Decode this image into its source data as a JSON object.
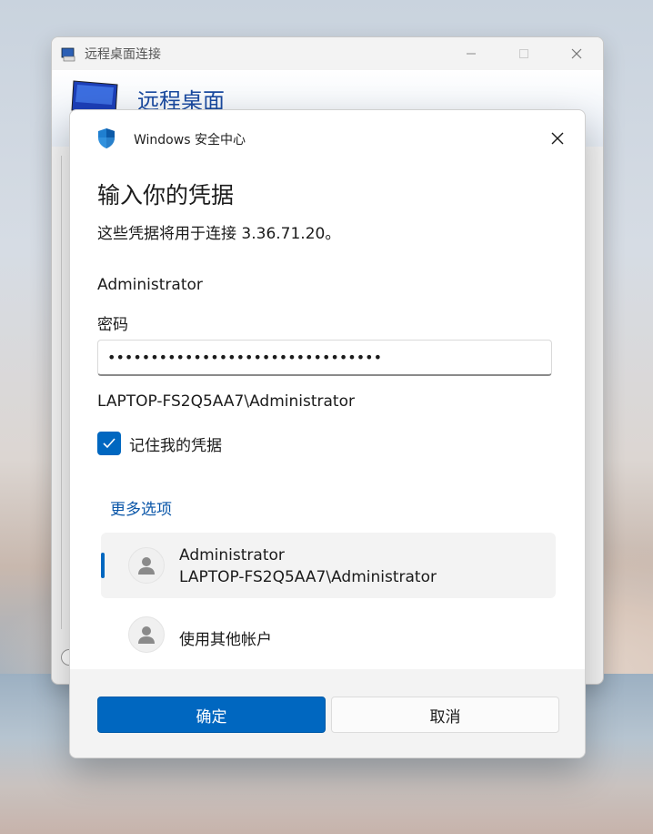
{
  "rdp_window": {
    "title": "远程桌面连接",
    "banner_title": "远程桌面"
  },
  "dialog": {
    "header_title": "Windows 安全中心",
    "heading": "输入你的凭据",
    "subtext": "这些凭据将用于连接 3.36.71.20。",
    "username": "Administrator",
    "password_label": "密码",
    "password_value": "••••••••••••••••••••••••••••••••",
    "account_full": "LAPTOP-FS2Q5AA7\\Administrator",
    "remember_label": "记住我的凭据",
    "remember_checked": true,
    "more_options": "更多选项",
    "options": [
      {
        "line1": "Administrator",
        "line2": "LAPTOP-FS2Q5AA7\\Administrator",
        "selected": true
      },
      {
        "line1": "使用其他帐户",
        "selected": false
      }
    ],
    "ok_label": "确定",
    "cancel_label": "取消"
  },
  "colors": {
    "accent": "#0067c0",
    "link": "#0a56a8"
  }
}
